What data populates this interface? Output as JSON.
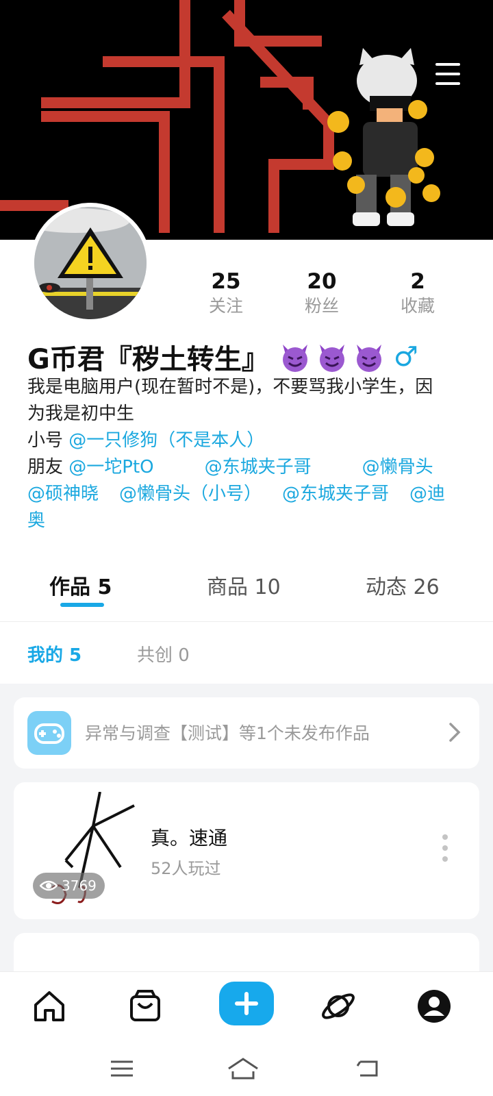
{
  "profile": {
    "name": "G币君『秽土转生』",
    "gender_symbol": "♂",
    "stats": [
      {
        "value": "25",
        "label": "关注"
      },
      {
        "value": "20",
        "label": "粉丝"
      },
      {
        "value": "2",
        "label": "收藏"
      }
    ],
    "bio": {
      "line1": "我是电脑用户(现在暂时不是)，不要骂我小学生，因",
      "line2": "为我是初中生",
      "alt_prefix": "小号 ",
      "alt_mention": "@一只修狗（不是本人）",
      "friends_prefix": "朋友 ",
      "friends_row1": [
        "@一坨PtO",
        "@东城夹子哥",
        "@懒骨头"
      ],
      "friends_row2": [
        "@硕神晓",
        "@懒骨头（小号）",
        "@东城夹子哥",
        "@迪"
      ],
      "friends_row3": "奥"
    }
  },
  "tabs": {
    "works": "作品 5",
    "goods": "商品 10",
    "activity": "动态 26"
  },
  "subtabs": {
    "mine": "我的 5",
    "cocreate": "共创 0"
  },
  "unpublished": {
    "text": "异常与调查【测试】等1个未发布作品"
  },
  "work": {
    "title": "真。速通",
    "played": "52人玩过",
    "views": "3769"
  },
  "icons": {
    "menu": "hamburger-icon",
    "home": "home-icon",
    "shop": "shopping-bag-icon",
    "create": "plus-icon",
    "explore": "planet-icon",
    "profile": "user-icon"
  },
  "colors": {
    "accent": "#19a8e6",
    "banner_red": "#c43a2f",
    "muted": "#9a9a9a"
  }
}
